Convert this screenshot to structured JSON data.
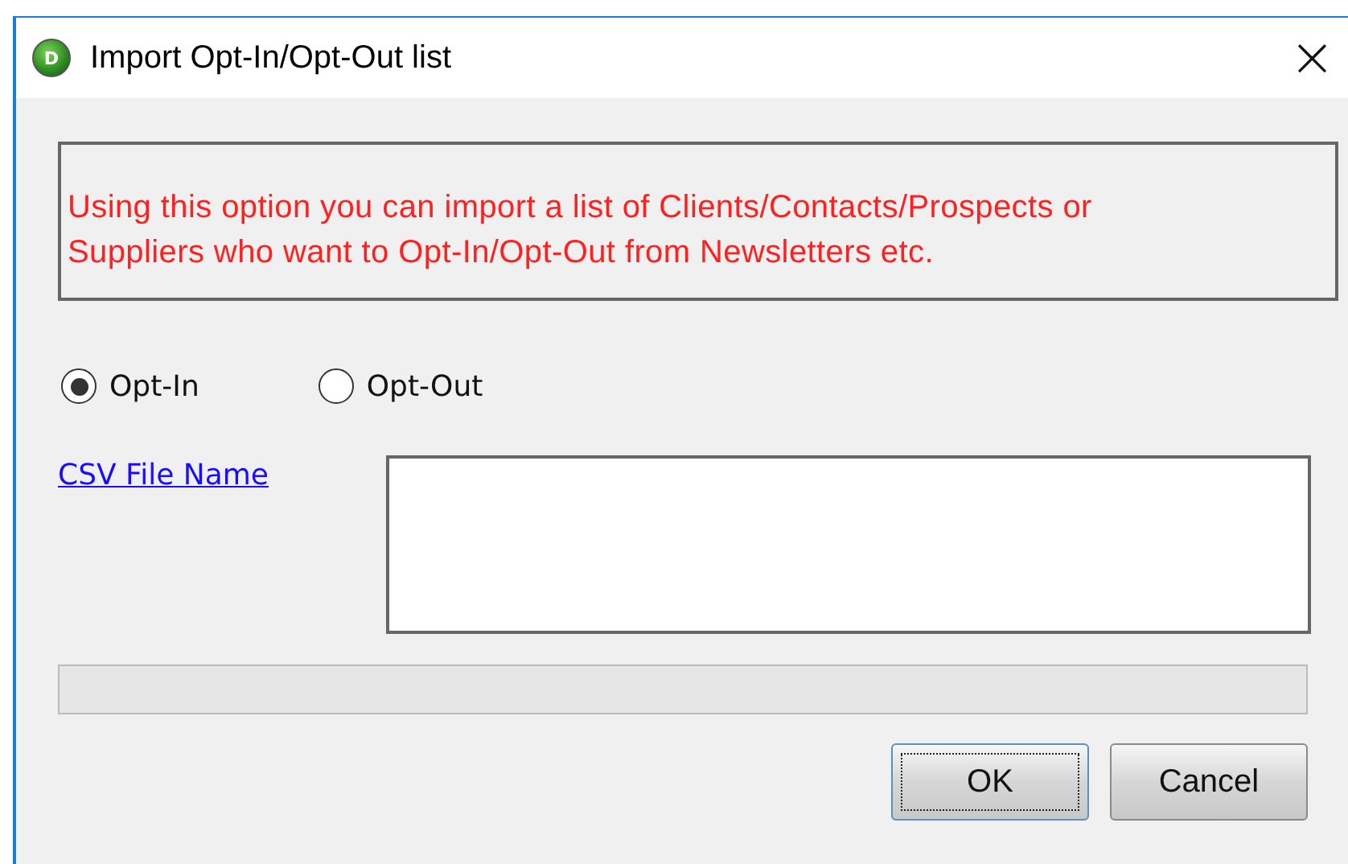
{
  "window": {
    "title": "Import Opt-In/Opt-Out list",
    "close": "×"
  },
  "app_icon": {
    "letter": "D"
  },
  "info_message": "Using this option you can import a list of Clients/Contacts/Prospects or Suppliers who want to Opt-In/Opt-Out from Newsletters etc.",
  "options": [
    {
      "label": "Opt-In",
      "selected": true
    },
    {
      "label": "Opt-Out",
      "selected": false
    }
  ],
  "csv_file": {
    "link": "CSV File Name"
  },
  "buttons": [
    {
      "label": "OK",
      "default": true
    },
    {
      "label": "Cancel",
      "default": false
    }
  ]
}
